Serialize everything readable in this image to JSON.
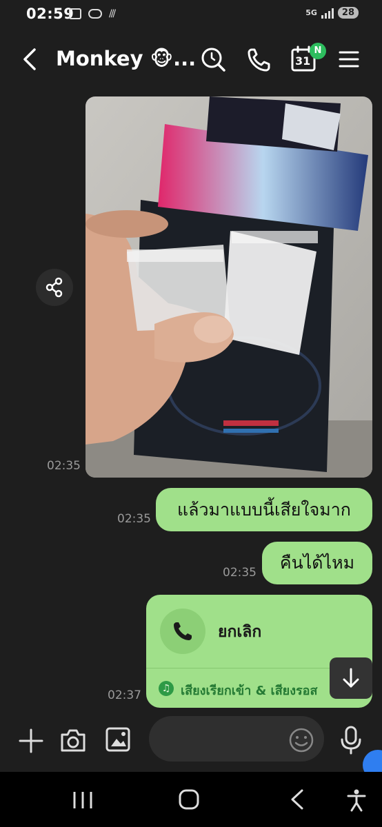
{
  "status_bar": {
    "time": "02:59",
    "network": "5G",
    "battery": "28"
  },
  "header": {
    "title": "Monkey 🐵...",
    "calendar_day": "31",
    "calendar_badge": "N"
  },
  "messages": [
    {
      "type": "image",
      "time": "02:35",
      "sender": "other"
    },
    {
      "type": "text",
      "text": "แล้วมาแบบนี้เสียใจมาก",
      "time": "02:35",
      "sender": "me"
    },
    {
      "type": "text",
      "text": "คืนได้ไหม",
      "time": "02:35",
      "sender": "me"
    },
    {
      "type": "call",
      "label": "ยกเลิก",
      "ringtone": "เสียงเรียกเข้า & เสียงรอส",
      "time": "02:37",
      "sender": "me"
    }
  ],
  "input": {
    "placeholder": ""
  },
  "colors": {
    "bubble": "#a0e08a",
    "background": "#1e1e1e",
    "accent_green": "#2dbd5e"
  }
}
